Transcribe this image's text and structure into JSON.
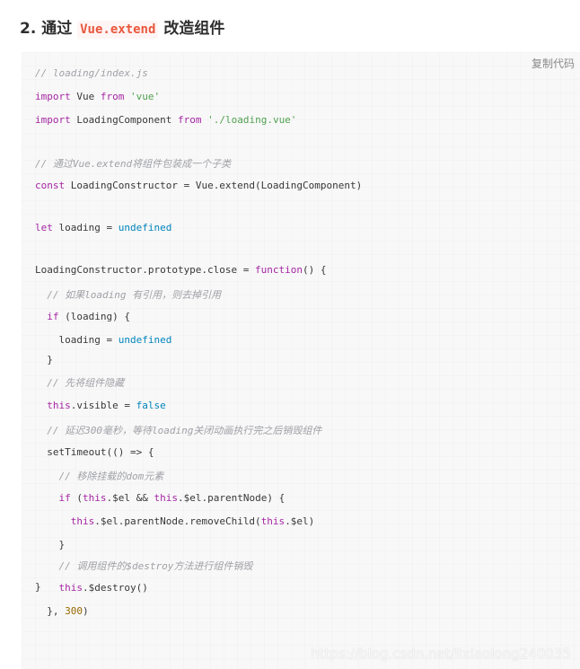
{
  "heading": {
    "prefix": "2. 通过 ",
    "code": "Vue.extend",
    "suffix": " 改造组件"
  },
  "copy_button": {
    "label": "复制代码"
  },
  "code": {
    "lines": [
      [
        {
          "t": "// loading/index.js",
          "c": "cm"
        }
      ],
      [
        {
          "t": "import",
          "c": "kw"
        },
        {
          "t": " Vue "
        },
        {
          "t": "from",
          "c": "kw"
        },
        {
          "t": " "
        },
        {
          "t": "'vue'",
          "c": "str"
        }
      ],
      [
        {
          "t": "import",
          "c": "kw"
        },
        {
          "t": " LoadingComponent "
        },
        {
          "t": "from",
          "c": "kw"
        },
        {
          "t": " "
        },
        {
          "t": "'./loading.vue'",
          "c": "str"
        }
      ],
      [],
      [
        {
          "t": "// 通过Vue.extend将组件包装成一个子类",
          "c": "cm"
        }
      ],
      [
        {
          "t": "const",
          "c": "kw"
        },
        {
          "t": " LoadingConstructor = Vue.extend(LoadingComponent)"
        }
      ],
      [],
      [
        {
          "t": "let",
          "c": "kw"
        },
        {
          "t": " loading = "
        },
        {
          "t": "undefined",
          "c": "lit"
        }
      ],
      [],
      [
        {
          "t": "LoadingConstructor.prototype.close = "
        },
        {
          "t": "function",
          "c": "kw"
        },
        {
          "t": "() {"
        }
      ],
      [
        {
          "t": "  "
        },
        {
          "t": "// 如果loading 有引用，则去掉引用",
          "c": "cm"
        }
      ],
      [
        {
          "t": "  "
        },
        {
          "t": "if",
          "c": "kw"
        },
        {
          "t": " (loading) {"
        }
      ],
      [
        {
          "t": "    loading = "
        },
        {
          "t": "undefined",
          "c": "lit"
        }
      ],
      [
        {
          "t": "  }"
        }
      ],
      [
        {
          "t": "  "
        },
        {
          "t": "// 先将组件隐藏",
          "c": "cm"
        }
      ],
      [
        {
          "t": "  "
        },
        {
          "t": "this",
          "c": "kw"
        },
        {
          "t": ".visible = "
        },
        {
          "t": "false",
          "c": "lit"
        }
      ],
      [
        {
          "t": "  "
        },
        {
          "t": "// 延迟300毫秒，等待loading关闭动画执行完之后销毁组件",
          "c": "cm"
        }
      ],
      [
        {
          "t": "  setTimeout(() => {"
        }
      ],
      [
        {
          "t": "    "
        },
        {
          "t": "// 移除挂载的dom元素",
          "c": "cm"
        }
      ],
      [
        {
          "t": "    "
        },
        {
          "t": "if",
          "c": "kw"
        },
        {
          "t": " ("
        },
        {
          "t": "this",
          "c": "kw"
        },
        {
          "t": ".$el && "
        },
        {
          "t": "this",
          "c": "kw"
        },
        {
          "t": ".$el.parentNode) {"
        }
      ],
      [
        {
          "t": "      "
        },
        {
          "t": "this",
          "c": "kw"
        },
        {
          "t": ".$el.parentNode.removeChild("
        },
        {
          "t": "this",
          "c": "kw"
        },
        {
          "t": ".$el)"
        }
      ],
      [
        {
          "t": "    }"
        }
      ],
      [
        {
          "t": "    "
        },
        {
          "t": "// 调用组件的$destroy方法进行组件销毁",
          "c": "cm"
        }
      ],
      [
        {
          "t": "    "
        },
        {
          "t": "this",
          "c": "kw"
        },
        {
          "t": ".$destroy()"
        }
      ],
      [
        {
          "t": "  }, "
        },
        {
          "t": "300",
          "c": "num"
        },
        {
          "t": ")"
        }
      ],
      [
        {
          "t": "}"
        }
      ]
    ]
  },
  "watermark": "https://blog.csdn.net/lixiaolong240035"
}
